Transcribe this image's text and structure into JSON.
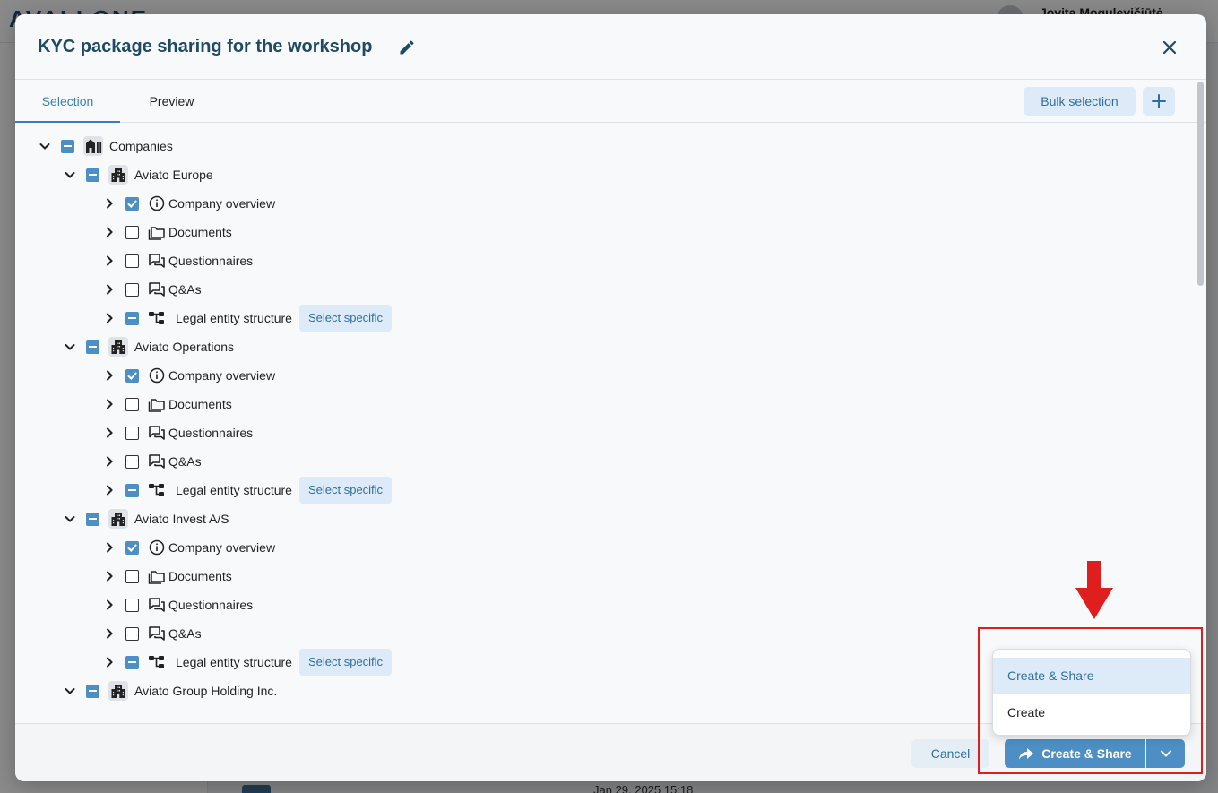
{
  "background": {
    "logo_text": "AVALLONE",
    "user_name": "Jovita Mogulevičiūtė",
    "date_text": "Jan 29, 2025 15:18"
  },
  "modal": {
    "title": "KYC package sharing for the workshop",
    "tabs": [
      {
        "label": "Selection",
        "active": true
      },
      {
        "label": "Preview",
        "active": false
      }
    ],
    "bulk_selection_label": "Bulk selection",
    "tree": {
      "root": {
        "label": "Companies",
        "state": "partial"
      },
      "companies": [
        {
          "name": "Aviato Europe",
          "state": "partial",
          "items": [
            {
              "label": "Company overview",
              "state": "checked",
              "icon": "info-icon"
            },
            {
              "label": "Documents",
              "state": "empty",
              "icon": "folder-icon"
            },
            {
              "label": "Questionnaires",
              "state": "empty",
              "icon": "chat-icon"
            },
            {
              "label": "Q&As",
              "state": "empty",
              "icon": "chat-icon"
            },
            {
              "label": "Legal entity structure",
              "state": "partial",
              "icon": "hierarchy-icon",
              "action": "Select specific"
            }
          ]
        },
        {
          "name": "Aviato Operations",
          "state": "partial",
          "items": [
            {
              "label": "Company overview",
              "state": "checked",
              "icon": "info-icon"
            },
            {
              "label": "Documents",
              "state": "empty",
              "icon": "folder-icon"
            },
            {
              "label": "Questionnaires",
              "state": "empty",
              "icon": "chat-icon"
            },
            {
              "label": "Q&As",
              "state": "empty",
              "icon": "chat-icon"
            },
            {
              "label": "Legal entity structure",
              "state": "partial",
              "icon": "hierarchy-icon",
              "action": "Select specific"
            }
          ]
        },
        {
          "name": "Aviato Invest A/S",
          "state": "partial",
          "items": [
            {
              "label": "Company overview",
              "state": "checked",
              "icon": "info-icon"
            },
            {
              "label": "Documents",
              "state": "empty",
              "icon": "folder-icon"
            },
            {
              "label": "Questionnaires",
              "state": "empty",
              "icon": "chat-icon"
            },
            {
              "label": "Q&As",
              "state": "empty",
              "icon": "chat-icon"
            },
            {
              "label": "Legal entity structure",
              "state": "partial",
              "icon": "hierarchy-icon",
              "action": "Select specific"
            }
          ]
        },
        {
          "name": "Aviato Group Holding Inc.",
          "state": "partial",
          "items": []
        }
      ]
    },
    "footer": {
      "cancel_label": "Cancel",
      "primary_label": "Create & Share"
    },
    "dropdown": {
      "options": [
        {
          "label": "Create & Share",
          "highlighted": true
        },
        {
          "label": "Create",
          "highlighted": false
        }
      ]
    }
  },
  "colors": {
    "accent": "#4d8fc4",
    "title": "#1f4a63",
    "annotation": "#e01e1e"
  }
}
